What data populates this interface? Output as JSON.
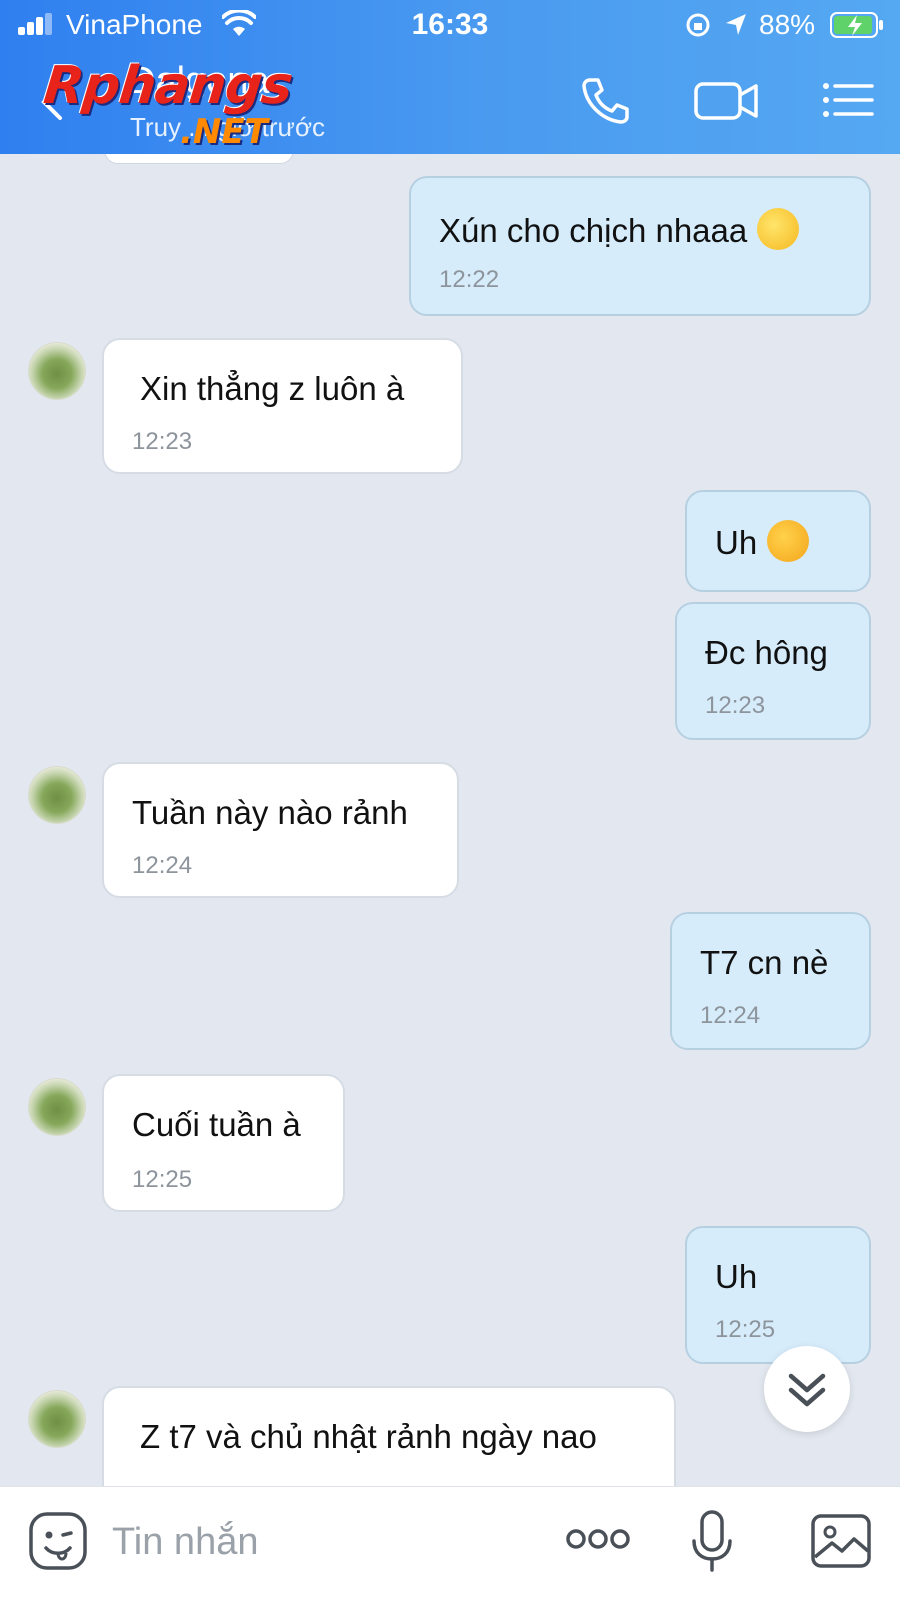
{
  "status_bar": {
    "carrier": "VinaPhone",
    "time": "16:33",
    "battery": "88%"
  },
  "header": {
    "title": "Dalgona",
    "subtitle": "Truy ... giờ trước",
    "watermark": "Rphangs",
    "watermark_suffix": ".NET"
  },
  "messages": [
    {
      "side": "out",
      "text": "Xún cho chịch nhaaa",
      "emoji": "thinking-face",
      "time": "12:22"
    },
    {
      "side": "in",
      "text": "Xin thẳng z luôn à",
      "time": "12:23"
    },
    {
      "side": "out",
      "text": "Uh",
      "emoji": "laughing-face",
      "time": ""
    },
    {
      "side": "out",
      "text": "Đc hông",
      "time": "12:23"
    },
    {
      "side": "in",
      "text": "Tuần này nào rảnh",
      "time": "12:24"
    },
    {
      "side": "out",
      "text": "T7 cn nè",
      "time": "12:24"
    },
    {
      "side": "in",
      "text": "Cuối tuần à",
      "time": "12:25"
    },
    {
      "side": "out",
      "text": "Uh",
      "time": "12:25"
    },
    {
      "side": "in",
      "text": "Z t7 và chủ nhật rảnh ngày nao",
      "time": ""
    }
  ],
  "input": {
    "placeholder": "Tin nhắn"
  },
  "colors": {
    "header_start": "#2f7ff0",
    "header_end": "#55a8f2",
    "outgoing_bubble": "#d6ecfb",
    "incoming_bubble": "#ffffff",
    "chat_background": "#e3e8f0"
  }
}
